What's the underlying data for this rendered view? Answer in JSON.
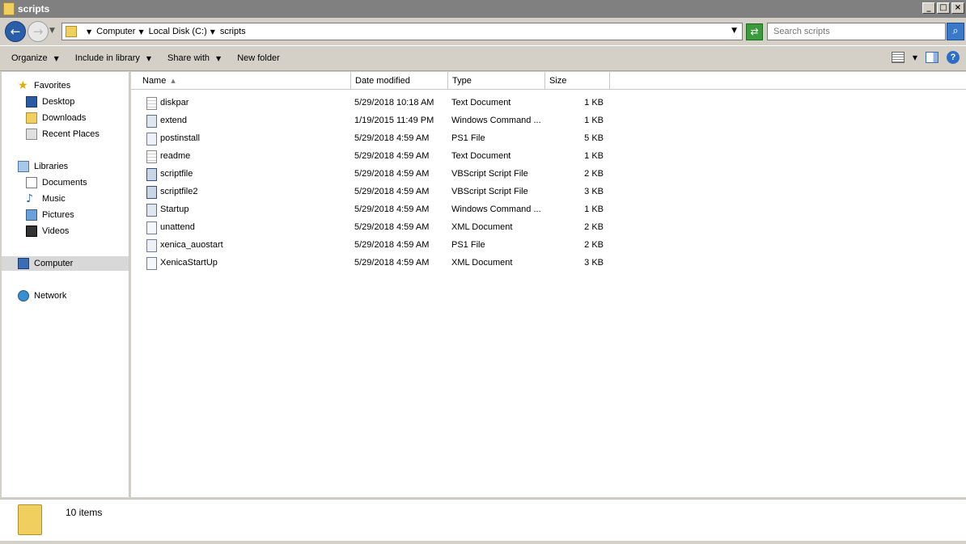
{
  "window": {
    "title": "scripts"
  },
  "address": {
    "crumbs": [
      "Computer",
      "Local Disk (C:)",
      "scripts"
    ],
    "search_placeholder": "Search scripts"
  },
  "toolbar": {
    "organize": "Organize",
    "include_in_library": "Include in library",
    "share_with": "Share with",
    "new_folder": "New folder"
  },
  "nav": {
    "favorites": "Favorites",
    "desktop": "Desktop",
    "downloads": "Downloads",
    "recent_places": "Recent Places",
    "libraries": "Libraries",
    "documents": "Documents",
    "music": "Music",
    "pictures": "Pictures",
    "videos": "Videos",
    "computer": "Computer",
    "network": "Network"
  },
  "columns": {
    "name": "Name",
    "date": "Date modified",
    "type": "Type",
    "size": "Size"
  },
  "files": [
    {
      "icon": "text-file-icon",
      "name": "diskpar",
      "date": "5/29/2018 10:18 AM",
      "type": "Text Document",
      "size": "1 KB"
    },
    {
      "icon": "command-script-icon",
      "name": "extend",
      "date": "1/19/2015 11:49 PM",
      "type": "Windows Command ...",
      "size": "1 KB"
    },
    {
      "icon": "ps1-file-icon",
      "name": "postinstall",
      "date": "5/29/2018 4:59 AM",
      "type": "PS1 File",
      "size": "5 KB"
    },
    {
      "icon": "text-file-icon",
      "name": "readme",
      "date": "5/29/2018 4:59 AM",
      "type": "Text Document",
      "size": "1 KB"
    },
    {
      "icon": "vbscript-file-icon",
      "name": "scriptfile",
      "date": "5/29/2018 4:59 AM",
      "type": "VBScript Script File",
      "size": "2 KB"
    },
    {
      "icon": "vbscript-file-icon",
      "name": "scriptfile2",
      "date": "5/29/2018 4:59 AM",
      "type": "VBScript Script File",
      "size": "3 KB"
    },
    {
      "icon": "command-script-icon",
      "name": "Startup",
      "date": "5/29/2018 4:59 AM",
      "type": "Windows Command ...",
      "size": "1 KB"
    },
    {
      "icon": "xml-file-icon",
      "name": "unattend",
      "date": "5/29/2018 4:59 AM",
      "type": "XML Document",
      "size": "2 KB"
    },
    {
      "icon": "ps1-file-icon",
      "name": "xenica_auostart",
      "date": "5/29/2018 4:59 AM",
      "type": "PS1 File",
      "size": "2 KB"
    },
    {
      "icon": "xml-file-icon",
      "name": "XenicaStartUp",
      "date": "5/29/2018 4:59 AM",
      "type": "XML Document",
      "size": "3 KB"
    }
  ],
  "status": {
    "item_count": "10 items"
  }
}
